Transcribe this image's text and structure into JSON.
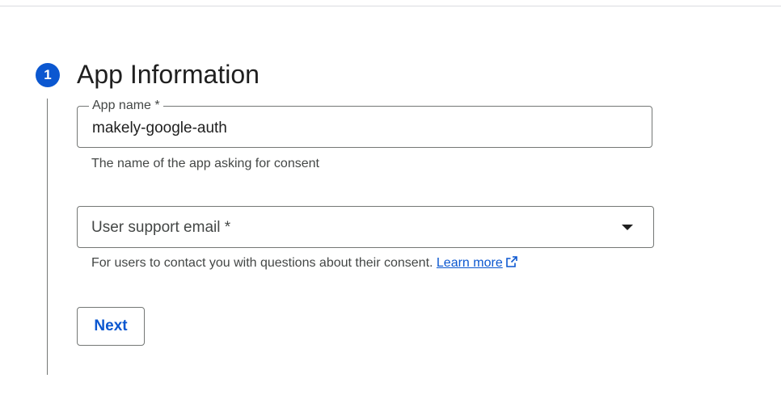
{
  "step": {
    "number": "1",
    "title": "App Information"
  },
  "app_name_field": {
    "label": "App name *",
    "value": "makely-google-auth",
    "hint": "The name of the app asking for consent"
  },
  "support_email_field": {
    "placeholder": "User support email *",
    "hint": "For users to contact you with questions about their consent.",
    "link_text": "Learn more"
  },
  "actions": {
    "next_label": "Next"
  },
  "colors": {
    "accent": "#0b57d0",
    "border": "#747775",
    "secondary_text": "#444746"
  },
  "icons": {
    "dropdown": "chevron-down-icon",
    "external_link": "open-in-new-icon"
  }
}
